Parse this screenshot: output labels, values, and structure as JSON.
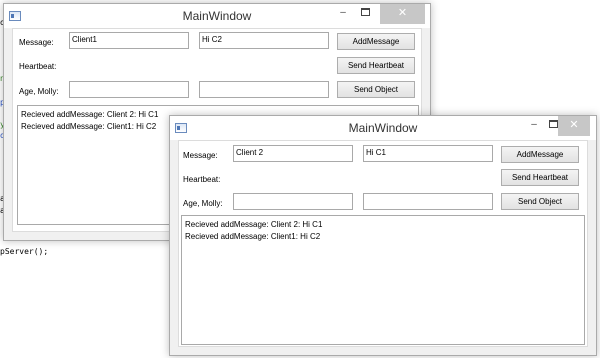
{
  "background_code": {
    "fragment_1": "pServer();",
    "fragment_2": "ar",
    "fragment_3": "ad",
    "fragment_4": "nt",
    "fragment_5": "p",
    "fragment_6": "yc",
    "fragment_7": "ol",
    "fragment_8": "ot"
  },
  "window_back": {
    "title": "MainWindow",
    "controls": {
      "minimize": "–",
      "maximize": "",
      "close": "✕"
    },
    "message_label": "Message:",
    "message_client": "Client1",
    "message_text": "Hi C2",
    "add_message_button": "AddMessage",
    "heartbeat_label": "Heartbeat:",
    "send_heartbeat_button": "Send Heartbeat",
    "age_label": "Age, Molly:",
    "age_value_1": "",
    "age_value_2": "",
    "send_object_button": "Send Object",
    "log": [
      "Recieved addMessage: Client 2: Hi C1",
      "Recieved addMessage: Client1: Hi C2"
    ]
  },
  "window_front": {
    "title": "MainWindow",
    "controls": {
      "minimize": "–",
      "maximize": "",
      "close": "✕"
    },
    "message_label": "Message:",
    "message_client": "Client 2",
    "message_text": "Hi C1",
    "add_message_button": "AddMessage",
    "heartbeat_label": "Heartbeat:",
    "send_heartbeat_button": "Send Heartbeat",
    "age_label": "Age, Molly:",
    "age_value_1": "",
    "age_value_2": "",
    "send_object_button": "Send Object",
    "log": [
      "Recieved addMessage: Client 2: Hi C1",
      "Recieved addMessage: Client1: Hi C2"
    ]
  }
}
